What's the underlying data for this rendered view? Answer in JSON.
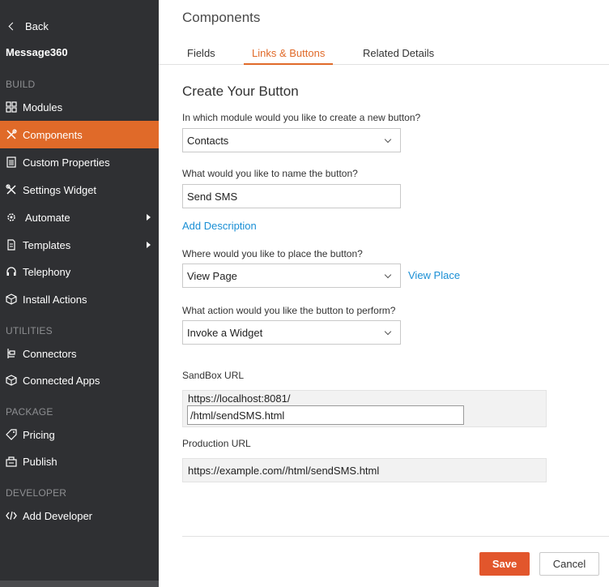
{
  "sidebar": {
    "back_label": "Back",
    "app_name": "Message360",
    "sections": {
      "build": "BUILD",
      "utilities": "UTILITIES",
      "package": "PACKAGE",
      "developer": "DEVELOPER"
    },
    "items": {
      "modules": "Modules",
      "components": "Components",
      "custom_properties": "Custom Properties",
      "settings_widget": "Settings Widget",
      "automate": "Automate",
      "templates": "Templates",
      "telephony": "Telephony",
      "install_actions": "Install Actions",
      "connectors": "Connectors",
      "connected_apps": "Connected Apps",
      "pricing": "Pricing",
      "publish": "Publish",
      "add_developer": "Add Developer"
    },
    "active_item": "Components",
    "active_color": "#e06a29"
  },
  "main": {
    "title": "Components",
    "tabs": {
      "fields": "Fields",
      "links_buttons": "Links & Buttons",
      "related_details": "Related Details"
    },
    "active_tab": "Links & Buttons",
    "form": {
      "title": "Create Your Button",
      "module_label": "In which module would you like to create a new button?",
      "module_value": "Contacts",
      "name_label": "What would you like to name the button?",
      "name_value": "Send SMS",
      "add_description": "Add Description",
      "place_label": "Where would you like to place the button?",
      "place_value": "View Page",
      "view_place": "View Place",
      "action_label": "What action would you like the button to perform?",
      "action_value": "Invoke a Widget",
      "sandbox_label": "SandBox URL",
      "sandbox_base": "https://localhost:8081/",
      "sandbox_path": "/html/sendSMS.html",
      "production_label": "Production URL",
      "production_value": "https://example.com//html/sendSMS.html"
    },
    "buttons": {
      "save": "Save",
      "cancel": "Cancel"
    }
  }
}
